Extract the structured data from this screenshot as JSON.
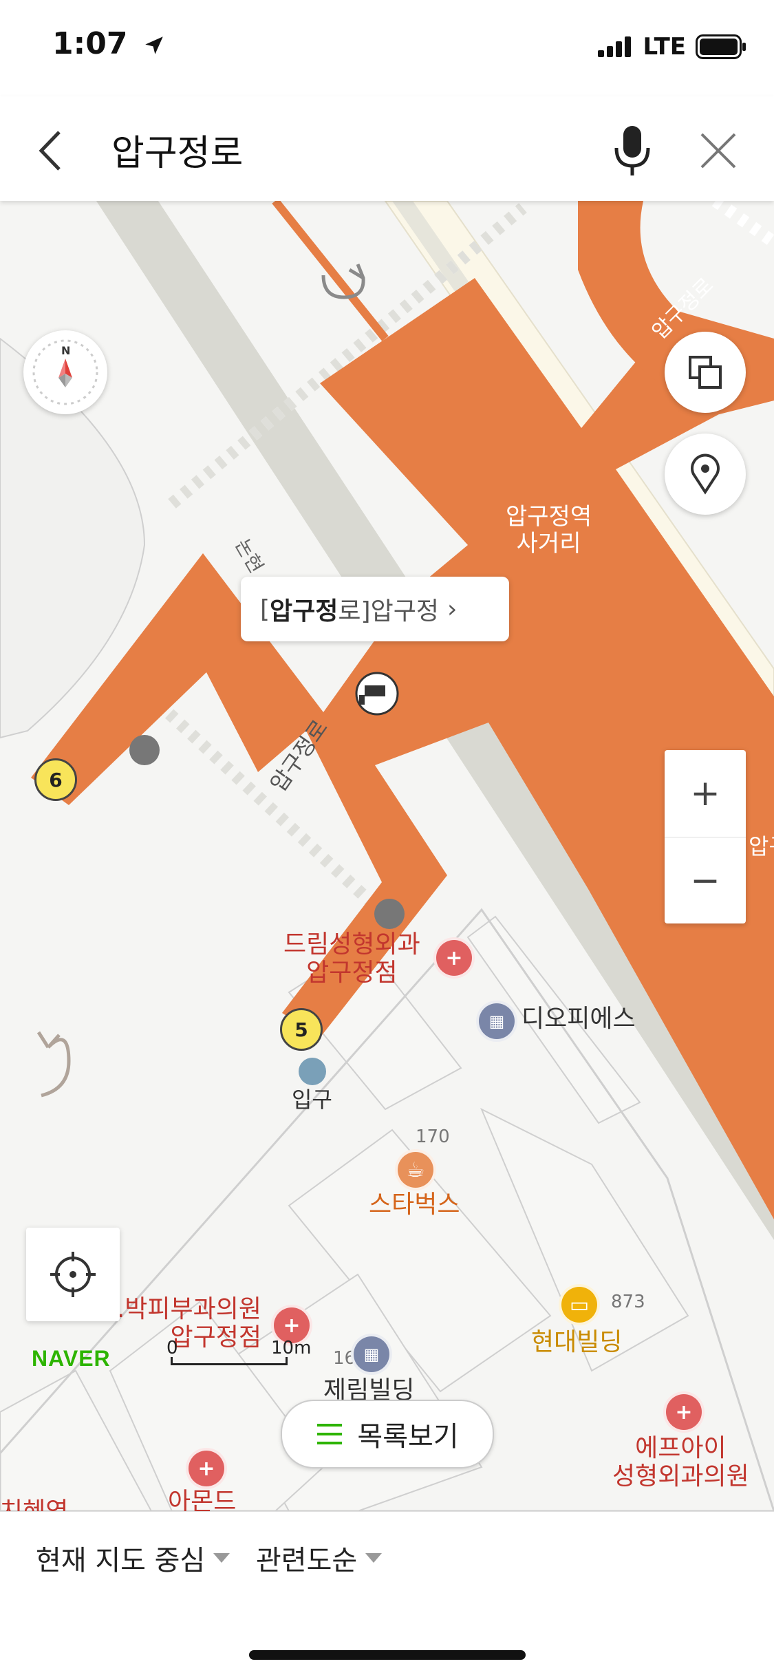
{
  "status_bar": {
    "time": "1:07",
    "carrier": "LTE"
  },
  "search": {
    "query": "압구정로"
  },
  "map": {
    "callout": {
      "bracket_open": "[",
      "highlight": "압구정",
      "rest": "로]",
      "place": " 압구정",
      "arrow": "›"
    },
    "road_labels": {
      "apgujeong_ro_top": "압구정로",
      "apgujeong_ro_mid": "압구정로",
      "nonhyeon": "논현",
      "apgu_right": "압구"
    },
    "intersection": {
      "line1": "압구정역",
      "line2": "사거리"
    },
    "exits": {
      "exit_6": "6",
      "exit_5": "5"
    },
    "pois": {
      "dream_clinic": {
        "line1": "드림성형외과",
        "line2": "압구정점"
      },
      "dioffice": "디오피에스",
      "entrance": "입구",
      "starbucks": {
        "name": "스타벅스",
        "number": "170"
      },
      "hyundai": {
        "name": "현대빌딩",
        "number": "873"
      },
      "skin_clinic": {
        "line1": "...박피부과의원",
        "line2": "압구정점"
      },
      "jerim": {
        "name": "제림빌딩",
        "number": "16"
      },
      "efai": {
        "line1": "에프아이",
        "line2": "성형외과의원"
      },
      "amond": "아몬드",
      "bottom_left": "치혜역"
    },
    "scale": {
      "zero": "0",
      "distance": "10m"
    },
    "brand": "NAVER",
    "list_button": "목록보기",
    "zoom": {
      "in": "+",
      "out": "−"
    }
  },
  "bottom_bar": {
    "filter_center": "현재 지도 중심",
    "filter_sort": "관련도순"
  },
  "colors": {
    "road_orange": "#e67e45",
    "road_gray": "#d9d9d2",
    "naver_green": "#2db400"
  }
}
